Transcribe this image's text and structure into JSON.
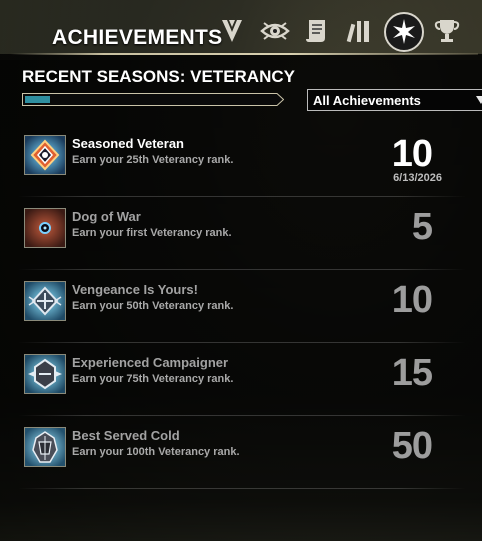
{
  "header": {
    "title": "ACHIEVEMENTS",
    "tabs": [
      {
        "icon": "champion-v-icon"
      },
      {
        "icon": "eye-icon"
      },
      {
        "icon": "scroll-icon"
      },
      {
        "icon": "books-icon"
      },
      {
        "icon": "star-emblem-icon",
        "active": true
      },
      {
        "icon": "trophy-icon"
      }
    ]
  },
  "section": {
    "title": "RECENT SEASONS: VETERANCY",
    "progress": 0.1
  },
  "filter": {
    "selected": "All Achievements"
  },
  "achievements": [
    {
      "name": "Seasoned Veteran",
      "description": "Earn your 25th Veterancy rank.",
      "points": "10",
      "date": "6/13/2026",
      "completed": true,
      "icon": "veteran-badge-icon"
    },
    {
      "name": "Dog of War",
      "description": "Earn your first Veterancy rank.",
      "points": "5",
      "completed": false,
      "icon": "war-orb-icon"
    },
    {
      "name": "Vengeance Is Yours!",
      "description": "Earn your 50th Veterancy rank.",
      "points": "10",
      "completed": false,
      "icon": "vengeance-emblem-icon"
    },
    {
      "name": "Experienced Campaigner",
      "description": "Earn your 75th Veterancy rank.",
      "points": "15",
      "completed": false,
      "icon": "campaigner-emblem-icon"
    },
    {
      "name": "Best Served Cold",
      "description": "Earn your 100th Veterancy rank.",
      "points": "50",
      "completed": false,
      "icon": "best-served-cold-icon"
    }
  ],
  "colors": {
    "accent": "#2f8fa0",
    "text_muted": "#a9a9a9"
  }
}
